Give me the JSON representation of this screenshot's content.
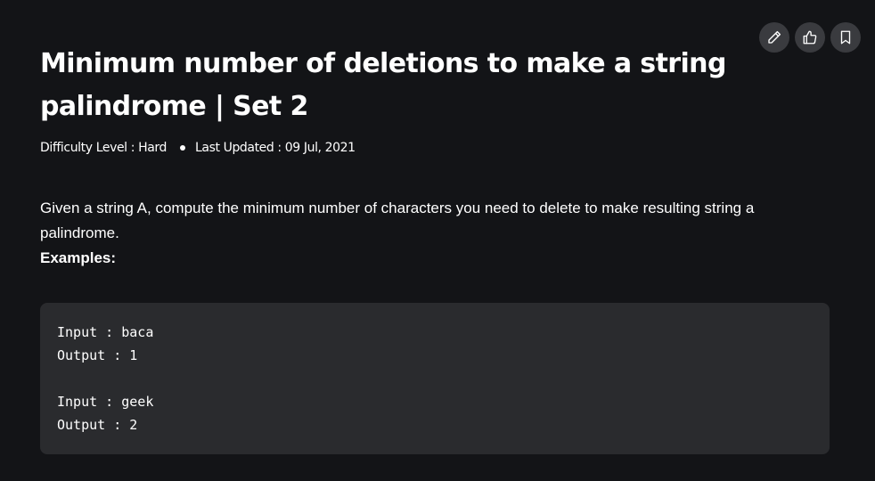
{
  "article": {
    "title": "Minimum number of deletions to make a string palindrome | Set 2",
    "difficulty": "Difficulty Level : Hard",
    "last_updated": "Last Updated : 09 Jul, 2021",
    "description": "Given a string A, compute the minimum number of characters you need to delete to make resulting string a palindrome.",
    "examples_label": "Examples:"
  },
  "code_example": {
    "lines": [
      "Input : baca",
      "Output : 1",
      "",
      "Input : geek",
      "Output : 2"
    ]
  },
  "actions": {
    "edit_icon": "pencil-icon",
    "like_icon": "thumbs-up-icon",
    "bookmark_icon": "bookmark-icon"
  }
}
